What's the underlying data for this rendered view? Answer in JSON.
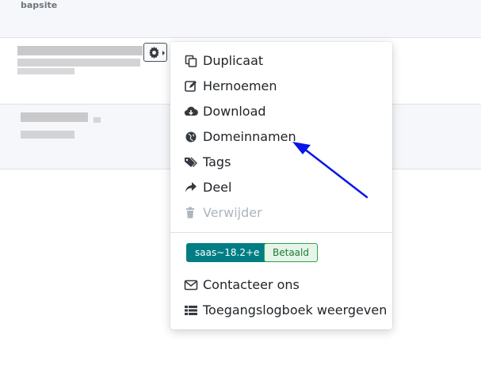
{
  "list": {
    "column_label": "bapsite"
  },
  "menu": {
    "items": [
      {
        "label": "Duplicaat",
        "icon": "duplicate-icon"
      },
      {
        "label": "Hernoemen",
        "icon": "edit-icon"
      },
      {
        "label": "Download",
        "icon": "cloud-download-icon"
      },
      {
        "label": "Domeinnamen",
        "icon": "globe-icon"
      },
      {
        "label": "Tags",
        "icon": "tags-icon"
      },
      {
        "label": "Deel",
        "icon": "share-icon"
      },
      {
        "label": "Verwijder",
        "icon": "trash-icon",
        "disabled": true
      }
    ],
    "badges": {
      "version": "saas~18.2+e",
      "status": "Betaald"
    },
    "footer_items": [
      {
        "label": "Contacteer ons",
        "icon": "envelope-icon"
      },
      {
        "label": "Toegangslogboek weergeven",
        "icon": "list-icon"
      }
    ]
  },
  "colors": {
    "accent": "#017e84",
    "annotation_arrow": "#0a16e8",
    "success": "#28a745"
  }
}
